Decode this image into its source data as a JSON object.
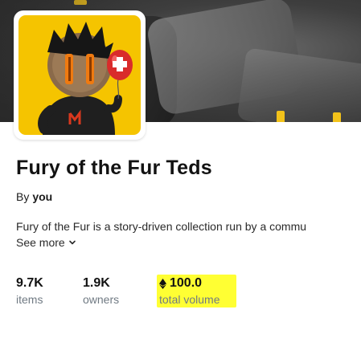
{
  "collection": {
    "name": "Fury of the Fur Teds",
    "by_label": "By",
    "owner": "you",
    "description": "Fury of the Fur is a story-driven collection run by a commu",
    "see_more_label": "See more"
  },
  "stats": {
    "items": {
      "value": "9.7K",
      "label": "items"
    },
    "owners": {
      "value": "1.9K",
      "label": "owners"
    },
    "volume": {
      "value": "100.0",
      "label": "total volume",
      "currency_icon": "ethereum-icon"
    }
  },
  "colors": {
    "avatar_bg": "#f5c400",
    "highlight": "#ffff33",
    "muted_text": "#707a83"
  }
}
